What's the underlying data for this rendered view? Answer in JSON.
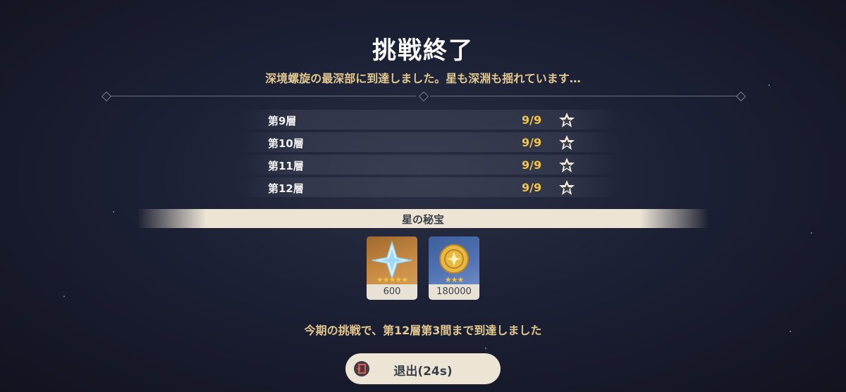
{
  "header": {
    "title": "挑戦終了",
    "subtitle": "深境螺旋の最深部に到達しました。星も深淵も揺れています…"
  },
  "floors": [
    {
      "name": "第9層",
      "score": "9/9",
      "icon": "abyss-star-icon"
    },
    {
      "name": "第10層",
      "score": "9/9",
      "icon": "abyss-star-icon"
    },
    {
      "name": "第11層",
      "score": "9/9",
      "icon": "abyss-star-icon"
    },
    {
      "name": "第12層",
      "score": "9/9",
      "icon": "abyss-star-icon"
    }
  ],
  "rewards": {
    "title": "星の秘宝",
    "items": [
      {
        "icon": "primogem-icon",
        "rarity": 5,
        "amount": "600"
      },
      {
        "icon": "mora-coin-icon",
        "rarity": 3,
        "amount": "180000"
      }
    ]
  },
  "progress_text": "今期の挑戦で、第12層第3間まで到達しました",
  "exit": {
    "label": "退出(24s)",
    "icon": "exit-door-icon"
  },
  "colors": {
    "gold_text": "#e2c88e",
    "score": "#f3c64a",
    "cream": "#ece5d6",
    "dark_text": "#3d3f48"
  }
}
